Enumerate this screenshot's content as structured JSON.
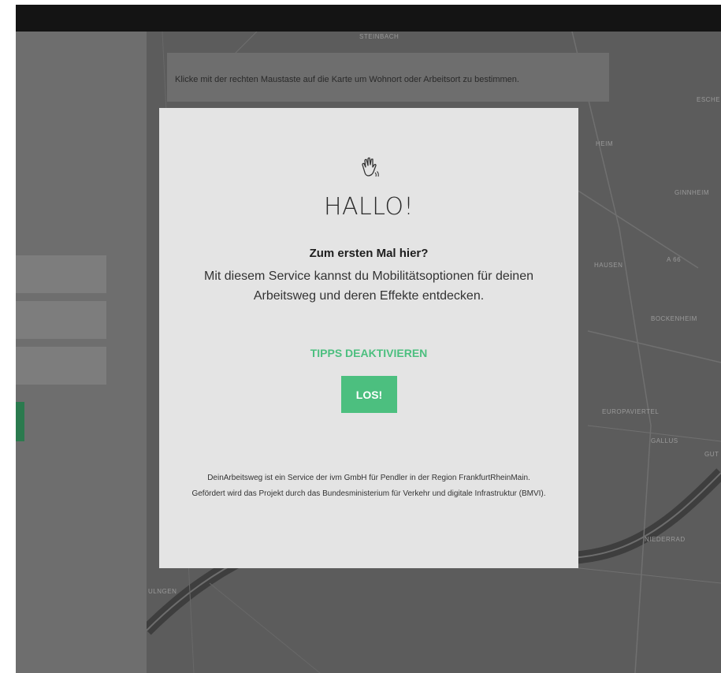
{
  "map": {
    "hint": "Klicke mit der rechten Maustaste auf die Karte um Wohnort oder Arbeitsort zu bestimmen.",
    "places": [
      "STEINBACH",
      "ESCHE",
      "HEIM",
      "GINNHEIM",
      "HAUSEN",
      "A 66",
      "BOCKENHEIM",
      "EUROPAVIERTEL",
      "GALLUS",
      "GUT",
      "NIEDERRAD",
      "ULNGEN"
    ]
  },
  "modal": {
    "icon": "waving-hand-icon",
    "title": "HALLO!",
    "question": "Zum ersten Mal hier?",
    "description": "Mit diesem Service kannst du Mobilitätsoptionen für deinen Arbeitsweg und deren Effekte entdecken.",
    "tips_link": "TIPPS DEAKTIVIEREN",
    "start_button": "LOS!",
    "footer": "DeinArbeitsweg ist ein Service der ivm GmbH für Pendler in der Region FrankfurtRheinMain. Gefördert wird das Projekt durch das Bundesministerium für Verkehr und digitale Infrastruktur (BMVI)."
  },
  "colors": {
    "accent": "#4cbf7f",
    "sidebar_green": "#2b7a4e"
  }
}
